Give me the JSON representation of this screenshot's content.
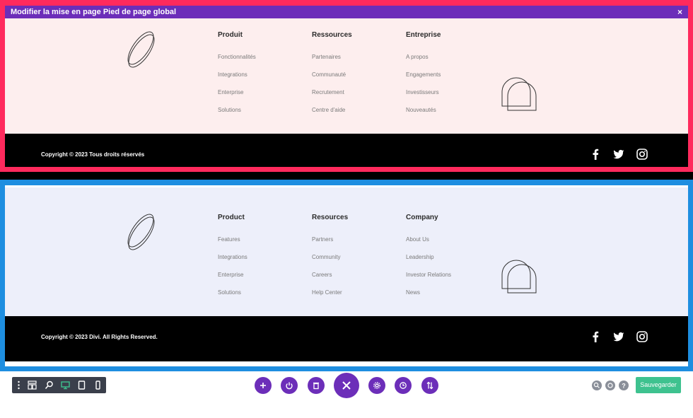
{
  "fr": {
    "modal_title": "Modifier la mise en page Pied de page global",
    "close_icon": "×",
    "columns": [
      {
        "heading": "Produit",
        "links": [
          "Fonctionnalités",
          "Integrations",
          "Enterprise",
          "Solutions"
        ]
      },
      {
        "heading": "Ressources",
        "links": [
          "Partenaires",
          "Communauté",
          "Recrutement",
          "Centre d'aide"
        ]
      },
      {
        "heading": "Entreprise",
        "links": [
          "A propos",
          "Engagements",
          "Investisseurs",
          "Nouveautés"
        ]
      }
    ],
    "copyright": "Copyright © 2023 Tous droits réservés"
  },
  "en": {
    "columns": [
      {
        "heading": "Product",
        "links": [
          "Features",
          "Integrations",
          "Enterprise",
          "Solutions"
        ]
      },
      {
        "heading": "Resources",
        "links": [
          "Partners",
          "Community",
          "Careers",
          "Help Center"
        ]
      },
      {
        "heading": "Company",
        "links": [
          "About Us",
          "Leadership",
          "Investor Relations",
          "News"
        ]
      }
    ],
    "copyright": "Copyright © 2023 Divi. All Rights Reserved."
  },
  "social_icons": [
    "facebook-icon",
    "twitter-icon",
    "instagram-icon"
  ],
  "toolbar": {
    "left_icons": [
      "menu-dots-icon",
      "layout-icon",
      "zoom-icon",
      "desktop-icon",
      "tablet-icon",
      "phone-icon"
    ],
    "center_icons": [
      "plus-icon",
      "power-icon",
      "trash-icon",
      "close-icon",
      "gear-icon",
      "history-icon",
      "sort-icon"
    ],
    "right_icons": [
      "search-icon",
      "portability-icon",
      "help-icon"
    ],
    "save_label": "Sauvegarder"
  },
  "colors": {
    "fr_border": "#ff2a5d",
    "en_border": "#1e8ee0",
    "modal_bar": "#6c2eb9",
    "save_button": "#3ec28f"
  }
}
